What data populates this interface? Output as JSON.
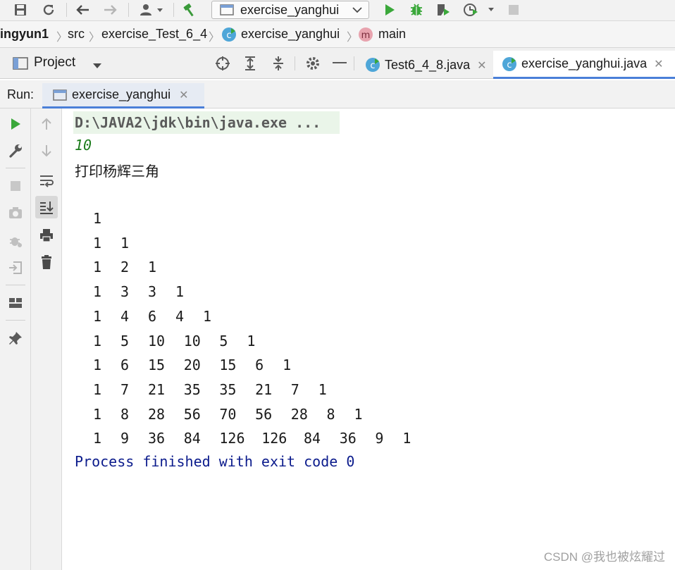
{
  "toolbar": {
    "run_config": "exercise_yanghui",
    "icons": [
      "save-icon",
      "sync-icon",
      "back-arrow-icon",
      "forward-arrow-icon",
      "user-icon",
      "hammer-icon",
      "run-icon",
      "debug-icon",
      "coverage-icon",
      "profiler-icon",
      "stop-icon"
    ]
  },
  "breadcrumb": {
    "items": [
      "ingyun1",
      "src",
      "exercise_Test_6_4",
      "exercise_yanghui",
      "main"
    ]
  },
  "project_bar": {
    "label": "Project"
  },
  "editor_tabs": [
    {
      "label": "Test6_4_8.java",
      "active": false
    },
    {
      "label": "exercise_yanghui.java",
      "active": true
    }
  ],
  "run_bar": {
    "label": "Run:",
    "tab_label": "exercise_yanghui"
  },
  "console": {
    "command": "D:\\JAVA2\\jdk\\bin\\java.exe ...",
    "input": "10",
    "heading": "打印杨辉三角",
    "rows": [
      [
        "1"
      ],
      [
        "1",
        "1"
      ],
      [
        "1",
        "2",
        "1"
      ],
      [
        "1",
        "3",
        "3",
        "1"
      ],
      [
        "1",
        "4",
        "6",
        "4",
        "1"
      ],
      [
        "1",
        "5",
        "10",
        "10",
        "5",
        "1"
      ],
      [
        "1",
        "6",
        "15",
        "20",
        "15",
        "6",
        "1"
      ],
      [
        "1",
        "7",
        "21",
        "35",
        "35",
        "21",
        "7",
        "1"
      ],
      [
        "1",
        "8",
        "28",
        "56",
        "70",
        "56",
        "28",
        "8",
        "1"
      ],
      [
        "1",
        "9",
        "36",
        "84",
        "126",
        "126",
        "84",
        "36",
        "9",
        "1"
      ]
    ],
    "finished": "Process finished with exit code 0"
  },
  "watermark": "CSDN @我也被炫耀过",
  "colors": {
    "accent": "#4a7fd8",
    "run_green": "#3aa83a",
    "process_text": "#0b1b8c",
    "input_text": "#1b7b1b"
  }
}
